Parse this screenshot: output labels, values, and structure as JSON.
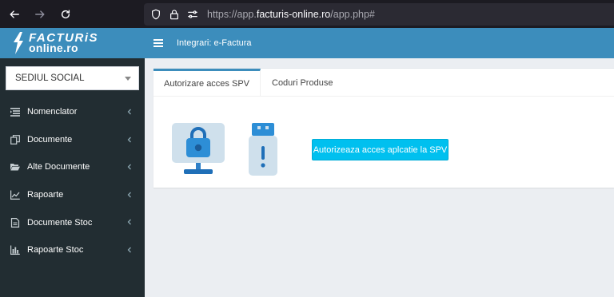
{
  "browser": {
    "url_prefix": "https://app.",
    "url_domain": "facturis-online.ro",
    "url_suffix": "/app.php#"
  },
  "logo": {
    "line1": "FACTURiS",
    "line2": "online.ro"
  },
  "company_select": {
    "value": "SEDIUL SOCIAL"
  },
  "sidebar": {
    "items": [
      {
        "label": "Nomenclator",
        "icon": "list-icon"
      },
      {
        "label": "Documente",
        "icon": "copy-icon"
      },
      {
        "label": "Alte Documente",
        "icon": "folder-open-icon"
      },
      {
        "label": "Rapoarte",
        "icon": "line-chart-icon"
      },
      {
        "label": "Documente Stoc",
        "icon": "file-text-icon"
      },
      {
        "label": "Rapoarte Stoc",
        "icon": "bar-chart-icon"
      }
    ]
  },
  "header": {
    "title": "Integrari: e-Factura"
  },
  "tabs": [
    {
      "label": "Autorizare acces SPV",
      "active": true
    },
    {
      "label": "Coduri Produse",
      "active": false
    }
  ],
  "main": {
    "authorize_button": "Autorizeaza acces aplcatie la SPV"
  },
  "colors": {
    "brand_blue": "#3c8dbc",
    "sidebar_bg": "#222d32",
    "button_cyan": "#00c0ef",
    "content_bg": "#ebeef2"
  }
}
